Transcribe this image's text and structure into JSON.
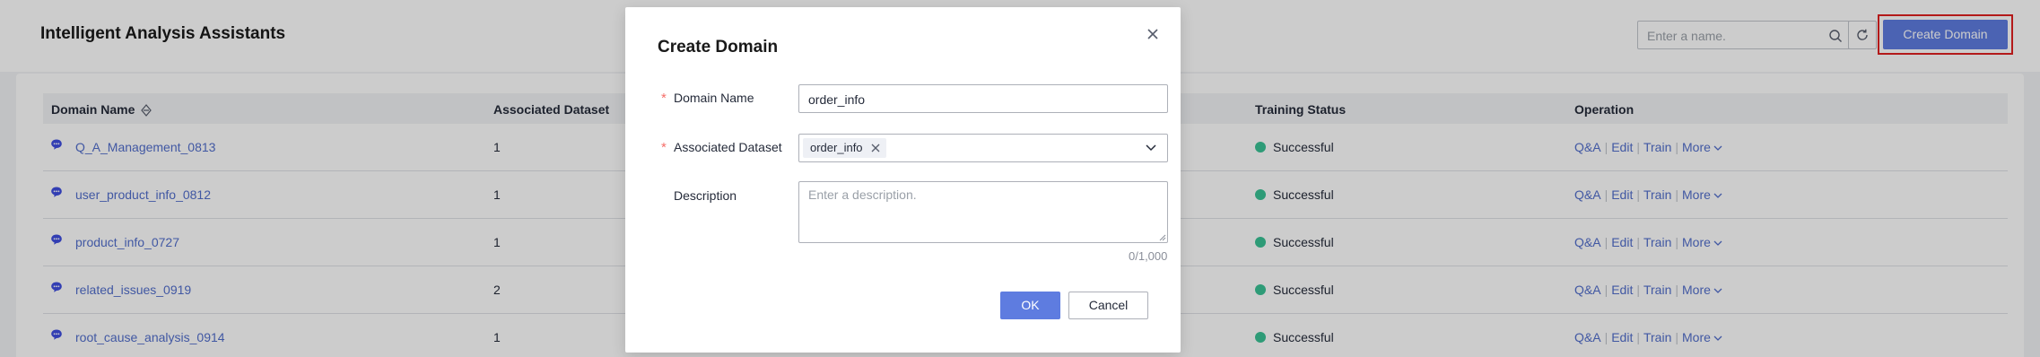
{
  "header": {
    "title": "Intelligent Analysis Assistants",
    "search_placeholder": "Enter a name.",
    "create_label": "Create Domain",
    "colors": {
      "accent": "#5e7ce0",
      "highlight": "#e02020"
    }
  },
  "table": {
    "columns": {
      "domain_name": "Domain Name",
      "associated_dataset": "Associated Dataset",
      "training_status": "Training Status",
      "operation": "Operation"
    },
    "rows": [
      {
        "name": "Q_A_Management_0813",
        "dataset": "1",
        "status": "Successful"
      },
      {
        "name": "user_product_info_0812",
        "dataset": "1",
        "status": "Successful"
      },
      {
        "name": "product_info_0727",
        "dataset": "1",
        "status": "Successful"
      },
      {
        "name": "related_issues_0919",
        "dataset": "2",
        "status": "Successful"
      },
      {
        "name": "root_cause_analysis_0914",
        "dataset": "1",
        "status": "Successful"
      }
    ],
    "ops": {
      "qa": "Q&A",
      "edit": "Edit",
      "train": "Train",
      "more": "More"
    },
    "status_color": "#3ac295"
  },
  "dialog": {
    "title": "Create Domain",
    "required_mark": "*",
    "domain_name_label": "Domain Name",
    "domain_name_value": "order_info",
    "dataset_label": "Associated Dataset",
    "dataset_tag": "order_info",
    "description_label": "Description",
    "description_placeholder": "Enter a description.",
    "counter": "0/1,000",
    "ok_label": "OK",
    "cancel_label": "Cancel"
  }
}
